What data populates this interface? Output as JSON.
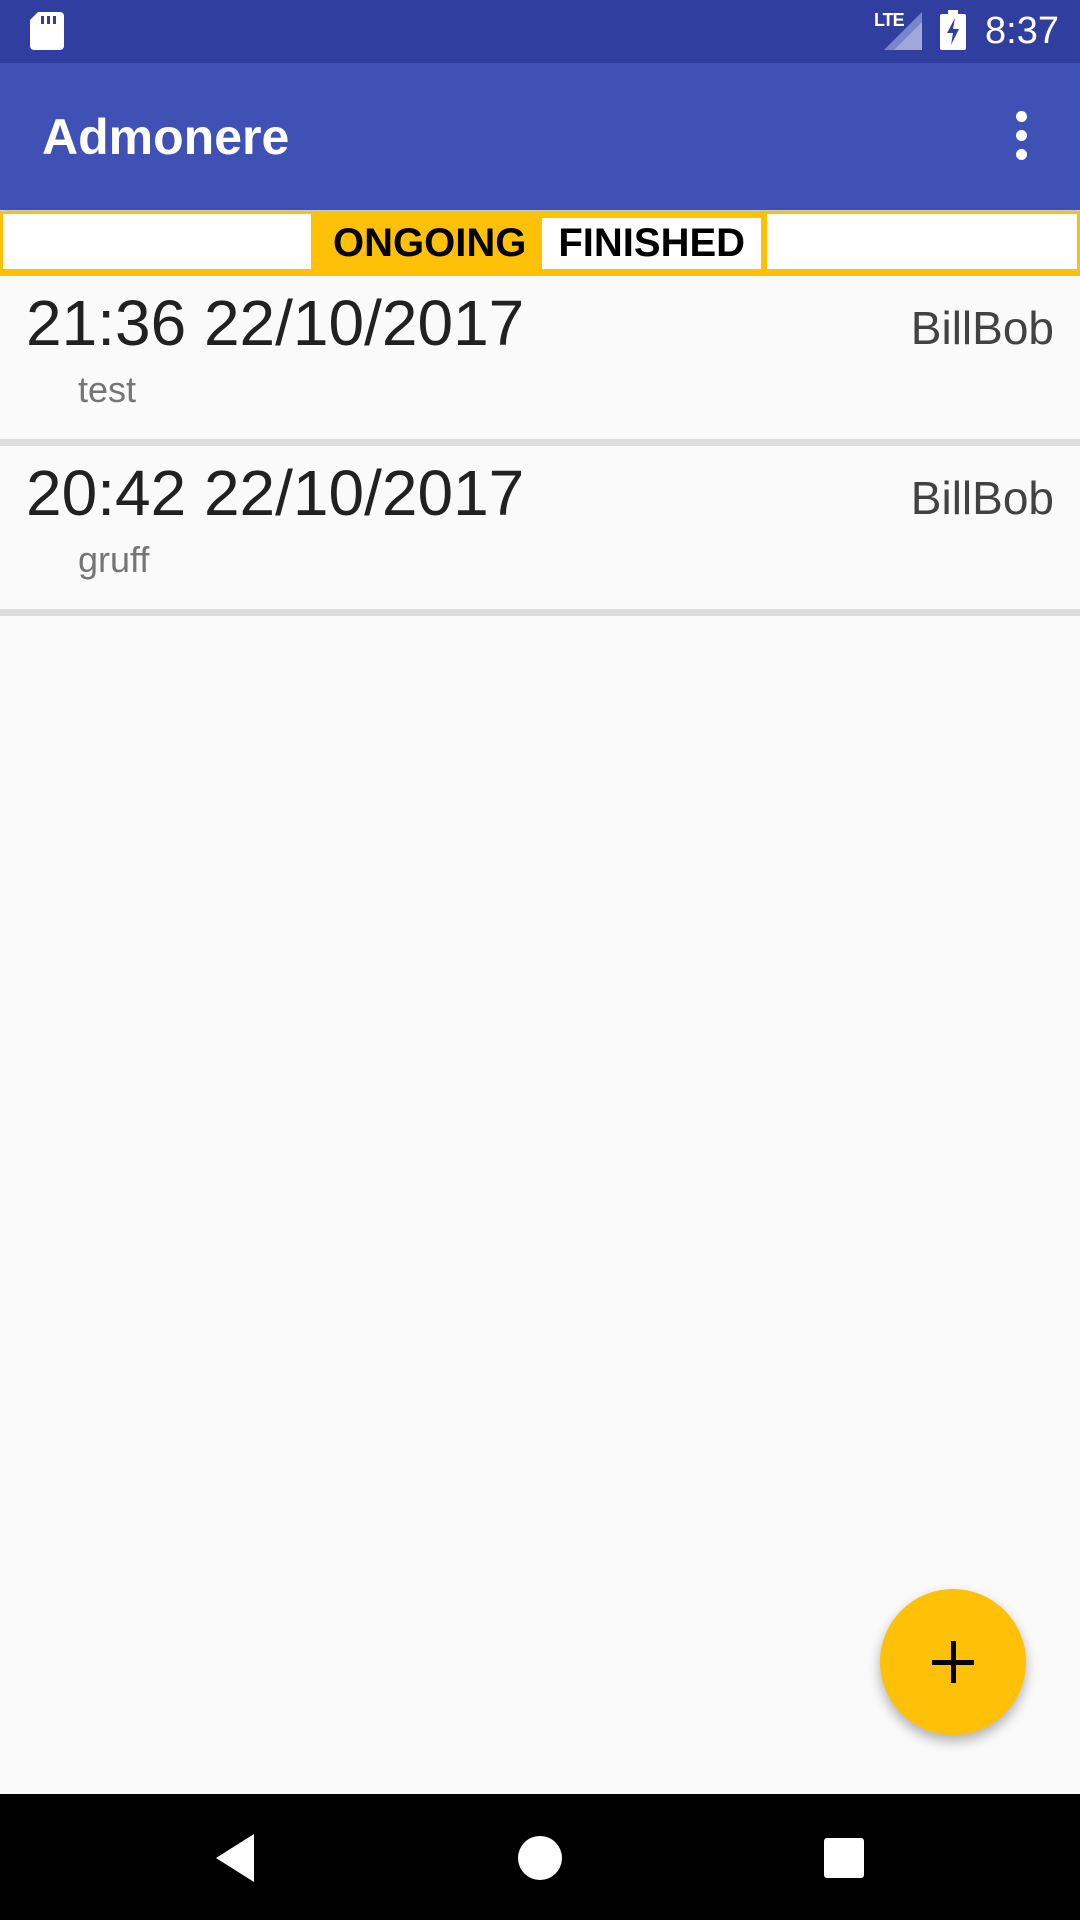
{
  "status_bar": {
    "network_label": "LTE",
    "time": "8:37",
    "icons": [
      "sd-card-icon",
      "signal-icon",
      "battery-charging-icon"
    ]
  },
  "app_bar": {
    "title": "Admonere",
    "menu_icon": "more-vert-icon"
  },
  "toggle": {
    "ongoing_label": "ONGOING",
    "finished_label": "FINISHED",
    "selected": "ONGOING"
  },
  "items": [
    {
      "datetime": "21:36 22/10/2017",
      "user": "BillBob",
      "note": "test"
    },
    {
      "datetime": "20:42 22/10/2017",
      "user": "BillBob",
      "note": "gruff"
    }
  ],
  "fab": {
    "icon": "plus-icon"
  },
  "nav_bar": {
    "icons": [
      "back-icon",
      "home-icon",
      "recents-icon"
    ]
  },
  "colors": {
    "status_bar": "#303f9f",
    "primary": "#3f51b5",
    "accent": "#ffc107",
    "background": "#fafafa"
  }
}
